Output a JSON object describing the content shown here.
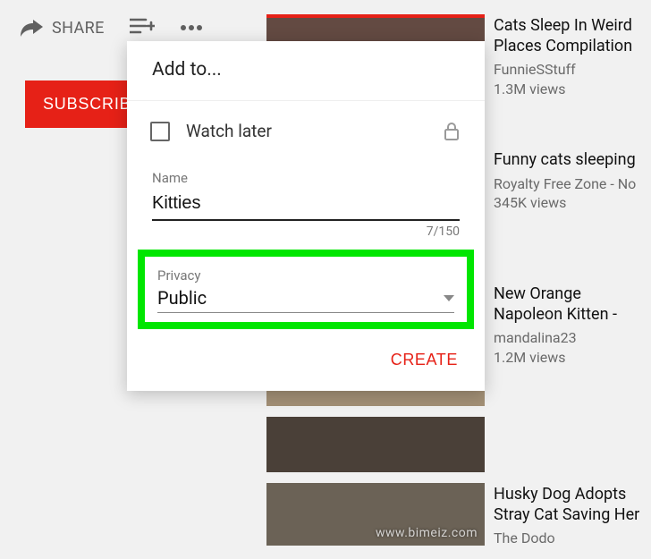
{
  "toolbar": {
    "share_label": "SHARE"
  },
  "subscribe_label": "SUBSCRIBE",
  "modal": {
    "title": "Add to...",
    "watch_later_label": "Watch later",
    "name_label": "Name",
    "name_value": "Kitties",
    "char_count": "7/150",
    "privacy_label": "Privacy",
    "privacy_value": "Public",
    "create_label": "CREATE"
  },
  "videos": [
    {
      "title": "Cats Sleep In Weird Places Compilation",
      "channel": "FunnieSStuff",
      "views": "1.3M views"
    },
    {
      "title": "Funny cats sleeping",
      "channel": "Royalty Free Zone - No",
      "views": "345K views"
    },
    {
      "title": "New Orange Napoleon Kitten -",
      "channel": "mandalina23",
      "views": "1.2M views"
    },
    {
      "title": "Husky Dog Adopts Stray Cat Saving Her",
      "channel": "The Dodo",
      "views": ""
    }
  ],
  "watermark": "www.bimeiz.com"
}
